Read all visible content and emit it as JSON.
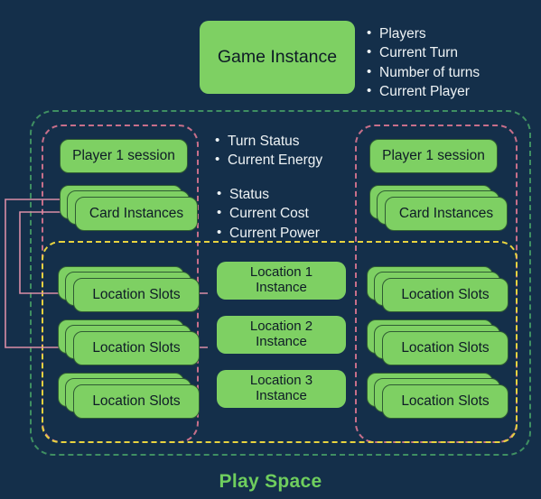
{
  "diagram": {
    "caption": "Play Space",
    "colors": {
      "background": "#142f4a",
      "node_fill": "#7ed063",
      "node_stroke": "#2f5c33",
      "node_text": "#0e1b26",
      "text": "#eef3f5",
      "caption": "#6fce5e",
      "region_play_space": "#3f8f62",
      "region_player": "#c76f8a",
      "region_locations": "#e8d33f",
      "connector": "#d98da6"
    },
    "game_instance": {
      "label": "Game Instance",
      "attributes": [
        "Players",
        "Current Turn",
        "Number of turns",
        "Current Player"
      ]
    },
    "session_attributes": [
      "Turn Status",
      "Current Energy"
    ],
    "card_attributes": [
      "Status",
      "Current Cost",
      "Current Power"
    ],
    "players": [
      {
        "session_label": "Player 1 session",
        "cards_label": "Card Instances",
        "location_slots": [
          "Location Slots",
          "Location Slots",
          "Location Slots"
        ]
      },
      {
        "session_label": "Player 1 session",
        "cards_label": "Card Instances",
        "location_slots": [
          "Location Slots",
          "Location Slots",
          "Location Slots"
        ]
      }
    ],
    "location_instances": [
      {
        "line1": "Location 1",
        "line2": "Instance"
      },
      {
        "line1": "Location 2",
        "line2": "Instance"
      },
      {
        "line1": "Location 3",
        "line2": "Instance"
      }
    ]
  }
}
